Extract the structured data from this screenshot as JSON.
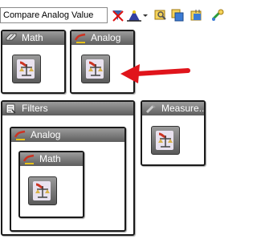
{
  "toolbar": {
    "search_value": "Compare Analog Value",
    "icons": [
      "clear-filter-icon",
      "wizard-icon",
      "dropdown-arrow-icon",
      "search-highlight-icon",
      "copy-icon",
      "library-icon",
      "connect-icon"
    ]
  },
  "blocks": {
    "math": {
      "title": "Math"
    },
    "analog": {
      "title": "Analog"
    },
    "filters": {
      "title": "Filters",
      "analog": {
        "title": "Analog"
      },
      "math": {
        "title": "Math"
      }
    },
    "measure": {
      "title": "Measure..."
    }
  },
  "colors": {
    "header_gradient_top": "#9c9c9c",
    "header_gradient_bottom": "#5e5e5e",
    "arrow": "#e0141b"
  }
}
